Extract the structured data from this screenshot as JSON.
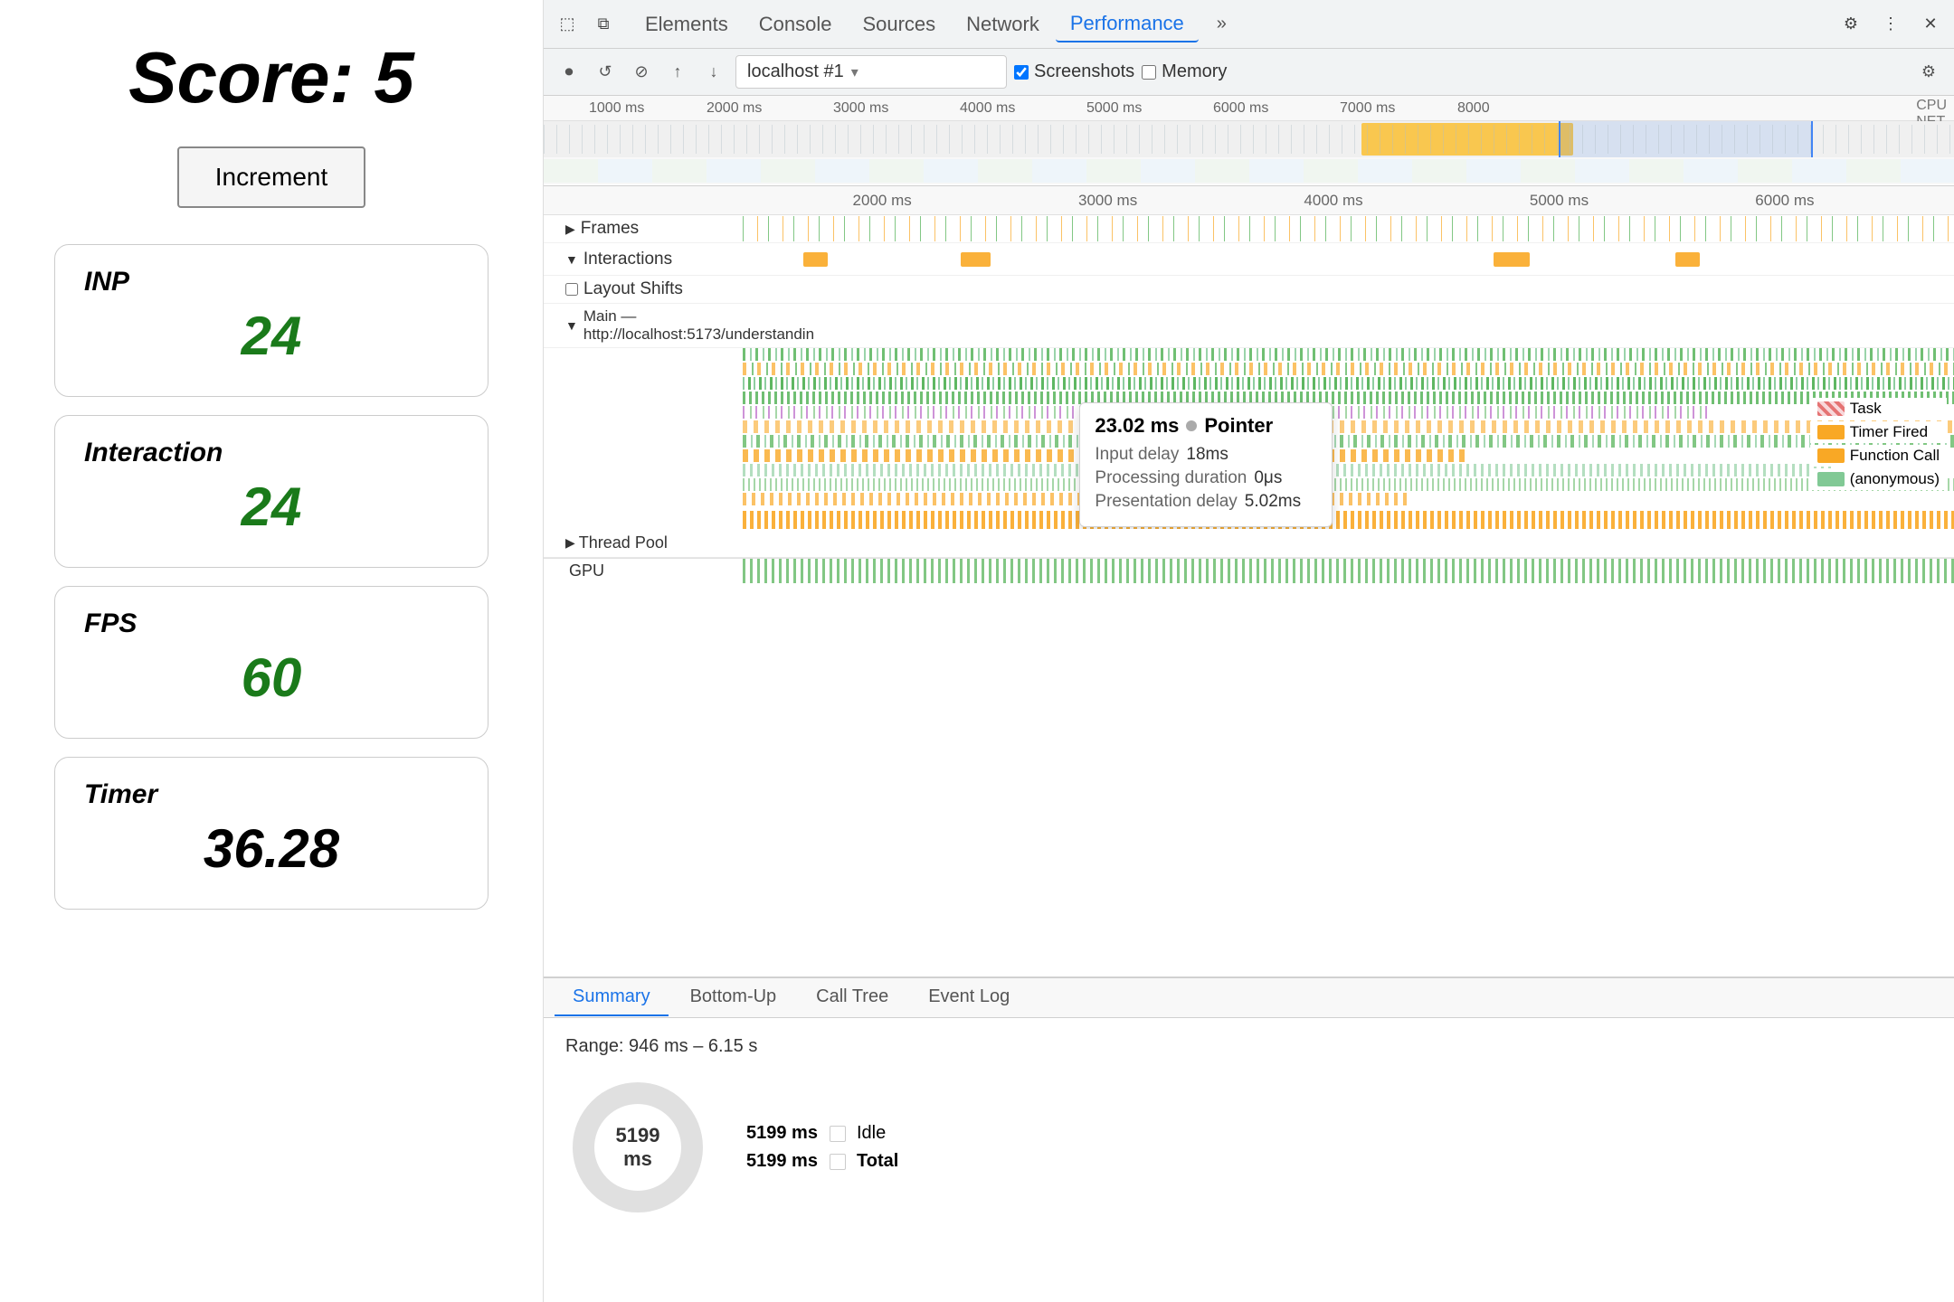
{
  "left": {
    "score_label": "Score:",
    "score_value": "5",
    "increment_btn": "Increment",
    "metrics": [
      {
        "label": "INP",
        "value": "24",
        "is_timer": false
      },
      {
        "label": "Interaction",
        "value": "24",
        "is_timer": false
      },
      {
        "label": "FPS",
        "value": "60",
        "is_timer": false
      },
      {
        "label": "Timer",
        "value": "36.28",
        "is_timer": true
      }
    ]
  },
  "devtools": {
    "tabs": [
      "Elements",
      "Console",
      "Sources",
      "Network",
      "Performance"
    ],
    "active_tab": "Performance",
    "more_label": "»",
    "toolbar": {
      "url": "localhost #1",
      "screenshots_label": "Screenshots",
      "memory_label": "Memory"
    },
    "timeline": {
      "ruler_marks": [
        "1000 ms",
        "2000 ms",
        "3000 ms",
        "4000 ms",
        "5000 ms",
        "6000 ms",
        "7000 ms",
        "8000"
      ],
      "cpu_label": "CPU",
      "net_label": "NET"
    },
    "main_ruler": [
      "2000 ms",
      "3000 ms",
      "4000 ms",
      "5000 ms",
      "6000 ms"
    ],
    "rows": [
      {
        "label": "Frames",
        "triangle": "▶"
      },
      {
        "label": "Interactions",
        "triangle": "▼"
      },
      {
        "label": "Layout Shifts",
        "triangle": ""
      },
      {
        "label": "Main — http://localhost:5173/understandin",
        "triangle": "▼"
      }
    ],
    "thread_pool_label": "Thread Pool",
    "gpu_label": "GPU",
    "tooltip": {
      "time": "23.02 ms",
      "event": "Pointer",
      "input_delay_label": "Input delay",
      "input_delay_val": "18ms",
      "processing_duration_label": "Processing duration",
      "processing_duration_val": "0μs",
      "presentation_delay_label": "Presentation delay",
      "presentation_delay_val": "5.02ms"
    },
    "legend": [
      {
        "label": "Task",
        "color": "#e57373",
        "pattern": "striped"
      },
      {
        "label": "Timer Fired",
        "color": "#f9a825"
      },
      {
        "label": "Function Call",
        "color": "#f9a825"
      },
      {
        "label": "(anonymous)",
        "color": "#81c995"
      }
    ],
    "bottom": {
      "tabs": [
        "Summary",
        "Bottom-Up",
        "Call Tree",
        "Event Log"
      ],
      "active_tab": "Summary",
      "range": "Range: 946 ms – 6.15 s",
      "donut_center": "5199 ms",
      "idle_label": "Idle",
      "idle_val": "5199 ms",
      "total_label": "Total",
      "total_val": "5199 ms"
    }
  }
}
